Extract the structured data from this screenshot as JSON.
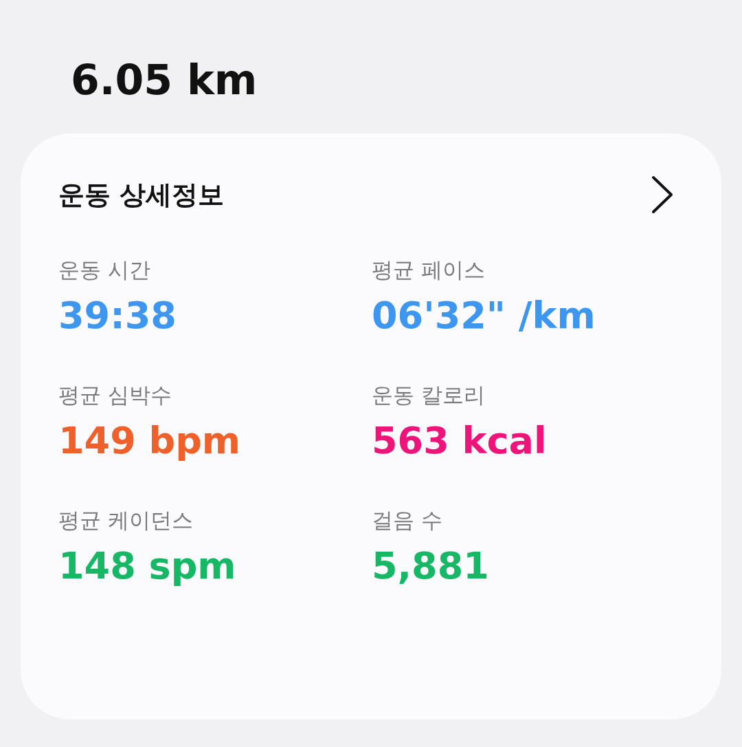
{
  "distance": "6.05 km",
  "card": {
    "title": "운동 상세정보",
    "stats": [
      {
        "label": "운동 시간",
        "value": "39:38",
        "color": "#3d97f0"
      },
      {
        "label": "평균 페이스",
        "value": "06'32\" /km",
        "color": "#3d97f0"
      },
      {
        "label": "평균 심박수",
        "value": "149 bpm",
        "color": "#f0602a"
      },
      {
        "label": "운동 칼로리",
        "value": "563 kcal",
        "color": "#ee1479"
      },
      {
        "label": "평균 케이던스",
        "value": "148 spm",
        "color": "#16b866"
      },
      {
        "label": "걸음 수",
        "value": "5,881",
        "color": "#16b866"
      }
    ]
  }
}
